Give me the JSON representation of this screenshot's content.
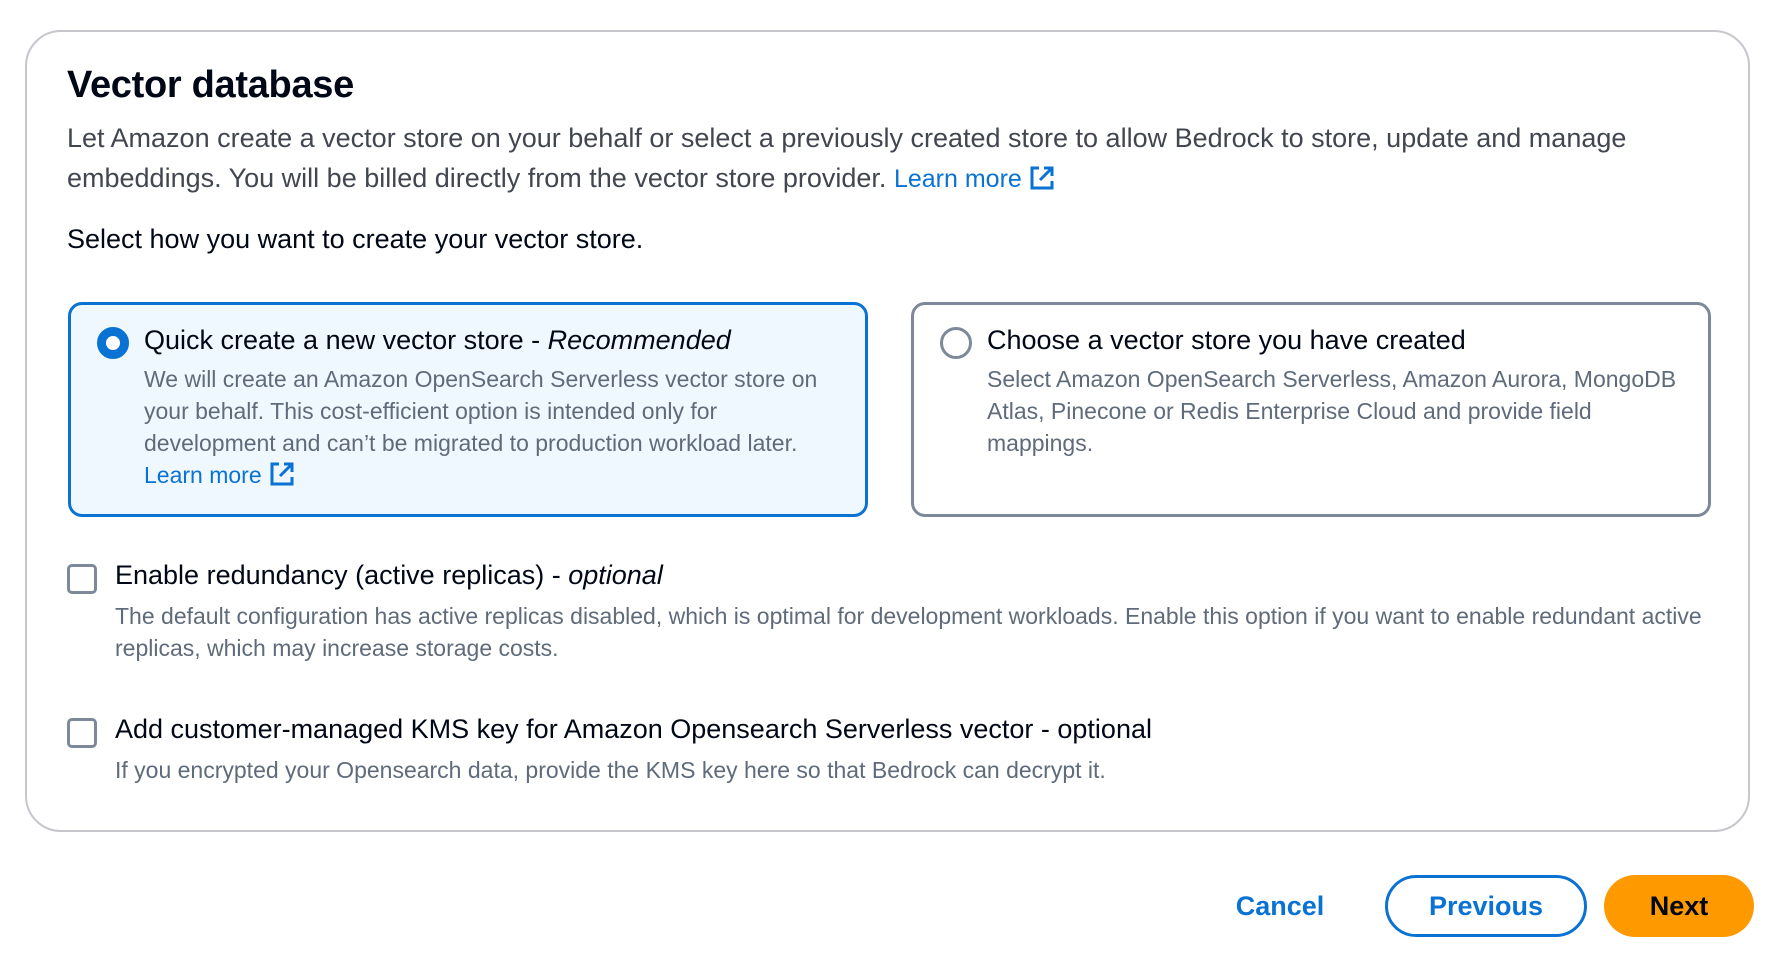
{
  "section": {
    "title": "Vector database",
    "description": "Let Amazon create a vector store on your behalf or select a previously created store to allow Bedrock to store, update and manage embeddings. You will be billed directly from the vector store provider.",
    "learn_more": "Learn more",
    "prompt": "Select how you want to create your vector store."
  },
  "options": [
    {
      "title": "Quick create a new vector store - ",
      "title_suffix": "Recommended",
      "description": "We will create an Amazon OpenSearch Serverless vector store on your behalf. This cost-efficient option is intended only for development and can’t be migrated to production workload later.",
      "learn_more": "Learn more",
      "selected": true
    },
    {
      "title": "Choose a vector store you have created",
      "description": "Select Amazon OpenSearch Serverless, Amazon Aurora, MongoDB Atlas, Pinecone or Redis Enterprise Cloud and provide field mappings.",
      "selected": false
    }
  ],
  "checkboxes": [
    {
      "label": "Enable redundancy (active replicas) - ",
      "label_suffix": "optional",
      "description": "The default configuration has active replicas disabled, which is optimal for development workloads. Enable this option if you want to enable redundant active replicas, which may increase storage costs.",
      "checked": false
    },
    {
      "label": "Add customer-managed KMS key for Amazon Opensearch Serverless vector - optional",
      "description": "If you encrypted your Opensearch data, provide the KMS key here so that Bedrock can decrypt it.",
      "checked": false
    }
  ],
  "footer": {
    "cancel_label": "Cancel",
    "previous_label": "Previous",
    "next_label": "Next"
  },
  "colors": {
    "accent": "#0972d3",
    "primary_button": "#ff9900",
    "border": "#c6c6cd",
    "muted_text": "#5f6b7a"
  }
}
